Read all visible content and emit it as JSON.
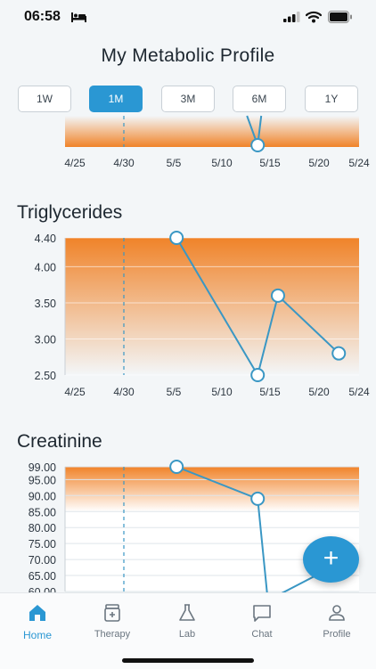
{
  "status": {
    "time": "06:58"
  },
  "page": {
    "title": "My Metabolic Profile"
  },
  "range_tabs": [
    {
      "label": "1W",
      "active": false
    },
    {
      "label": "1M",
      "active": true
    },
    {
      "label": "3M",
      "active": false
    },
    {
      "label": "6M",
      "active": false
    },
    {
      "label": "1Y",
      "active": false
    }
  ],
  "sections": {
    "triglycerides": {
      "title": "Triglycerides"
    },
    "creatinine": {
      "title": "Creatinine"
    }
  },
  "colors": {
    "accent": "#2a97d3",
    "band": "#f07d1e",
    "line": "#3a97c4"
  },
  "chart_data": [
    {
      "type": "line",
      "title": "",
      "x_tick_labels": [
        "4/25",
        "4/30",
        "5/5",
        "5/10",
        "5/15",
        "5/20",
        "5/24"
      ],
      "reference_x": "4/30",
      "points": [
        {
          "x": "5/14",
          "y": null
        }
      ],
      "note": "chart partially scrolled out of view; only the lowest point and band are visible"
    },
    {
      "type": "line",
      "title": "Triglycerides",
      "x_tick_labels": [
        "4/25",
        "4/30",
        "5/5",
        "5/10",
        "5/15",
        "5/20",
        "5/24"
      ],
      "y_tick_labels": [
        "4.40",
        "4.00",
        "3.50",
        "3.00",
        "2.50"
      ],
      "ylim": [
        2.5,
        4.4
      ],
      "reference_x": "4/30",
      "band": [
        2.5,
        4.4
      ],
      "series": [
        {
          "points": [
            {
              "x": "5/6",
              "y": 4.4
            },
            {
              "x": "5/14",
              "y": 2.5
            },
            {
              "x": "5/16",
              "y": 3.6
            },
            {
              "x": "5/22",
              "y": 2.8
            }
          ]
        }
      ]
    },
    {
      "type": "line",
      "title": "Creatinine",
      "y_tick_labels": [
        "99.00",
        "95.00",
        "90.00",
        "85.00",
        "80.00",
        "75.00",
        "70.00",
        "65.00",
        "60.00"
      ],
      "ylim": [
        60,
        99
      ],
      "reference_x": "4/30",
      "band": [
        85,
        99
      ],
      "series": [
        {
          "points": [
            {
              "x": "5/6",
              "y": 99
            },
            {
              "x": "5/14",
              "y": 89
            },
            {
              "x": "5/15",
              "y": 60
            },
            {
              "x": "5/24",
              "y": 60
            }
          ]
        }
      ]
    }
  ],
  "tab_bar": [
    {
      "label": "Home",
      "icon": "home-icon",
      "active": true
    },
    {
      "label": "Therapy",
      "icon": "therapy-icon",
      "active": false
    },
    {
      "label": "Lab",
      "icon": "lab-flask-icon",
      "active": false
    },
    {
      "label": "Chat",
      "icon": "chat-icon",
      "active": false
    },
    {
      "label": "Profile",
      "icon": "profile-icon",
      "active": false
    }
  ]
}
